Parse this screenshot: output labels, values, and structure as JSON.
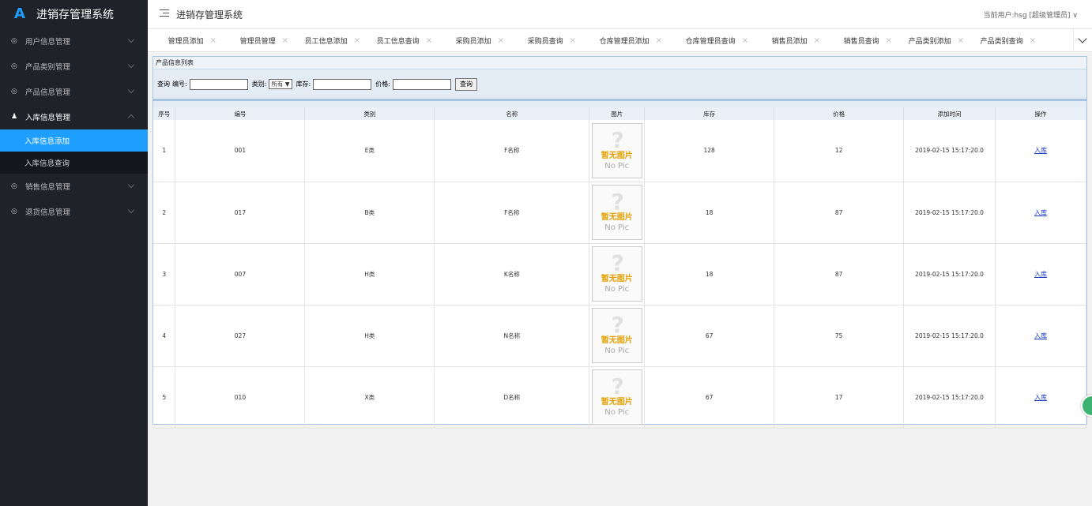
{
  "app": {
    "logo_text": "A",
    "title": "进销存管理系统",
    "header_title": "进销存管理系统",
    "user_info": "当前用户:hsg [超级管理员]"
  },
  "sidebar": {
    "items": [
      {
        "label": "用户信息管理",
        "icon": "circle-icon"
      },
      {
        "label": "产品类别管理",
        "icon": "circle-icon"
      },
      {
        "label": "产品信息管理",
        "icon": "circle-icon"
      },
      {
        "label": "入库信息管理",
        "icon": "user-icon"
      },
      {
        "label": "销售信息管理",
        "icon": "circle-icon"
      },
      {
        "label": "退货信息管理",
        "icon": "circle-icon"
      }
    ],
    "subitems": [
      {
        "label": "入库信息添加"
      },
      {
        "label": "入库信息查询"
      }
    ]
  },
  "tabs": [
    {
      "label": "管理员添加"
    },
    {
      "label": "管理员管理"
    },
    {
      "label": "员工信息添加"
    },
    {
      "label": "员工信息查询"
    },
    {
      "label": "采购员添加"
    },
    {
      "label": "采购员查询"
    },
    {
      "label": "仓库管理员添加"
    },
    {
      "label": "仓库管理员查询"
    },
    {
      "label": "销售员添加"
    },
    {
      "label": "销售员查询"
    },
    {
      "label": "产品类别添加"
    },
    {
      "label": "产品类别查询"
    }
  ],
  "panel": {
    "title": "产品信息列表",
    "search": {
      "query_label": "查询",
      "code_label": "编号:",
      "category_label": "类别:",
      "category_value": "所有 ▼",
      "stock_label": "库存:",
      "price_label": "价格:",
      "button": "查询"
    },
    "columns": [
      "序号",
      "编号",
      "类别",
      "名称",
      "图片",
      "库存",
      "价格",
      "添加时间",
      "操作"
    ],
    "nopic": {
      "zh": "暂无图片",
      "en": "No Pic"
    },
    "rows": [
      {
        "seq": "1",
        "code": "001",
        "category": "E类",
        "name": "F名称",
        "stock": "128",
        "price": "12",
        "time": "2019-02-15 15:17:20.0",
        "action": "入库"
      },
      {
        "seq": "2",
        "code": "017",
        "category": "B类",
        "name": "F名称",
        "stock": "18",
        "price": "87",
        "time": "2019-02-15 15:17:20.0",
        "action": "入库"
      },
      {
        "seq": "3",
        "code": "007",
        "category": "H类",
        "name": "K名称",
        "stock": "18",
        "price": "87",
        "time": "2019-02-15 15:17:20.0",
        "action": "入库"
      },
      {
        "seq": "4",
        "code": "027",
        "category": "H类",
        "name": "N名称",
        "stock": "67",
        "price": "75",
        "time": "2019-02-15 15:17:20.0",
        "action": "入库"
      },
      {
        "seq": "5",
        "code": "010",
        "category": "X类",
        "name": "D名称",
        "stock": "67",
        "price": "17",
        "time": "2019-02-15 15:17:20.0",
        "action": "入库"
      }
    ]
  },
  "colors": {
    "accent": "#1e9fff",
    "sidebar_bg": "#20222a",
    "link": "#1a3bc0"
  }
}
